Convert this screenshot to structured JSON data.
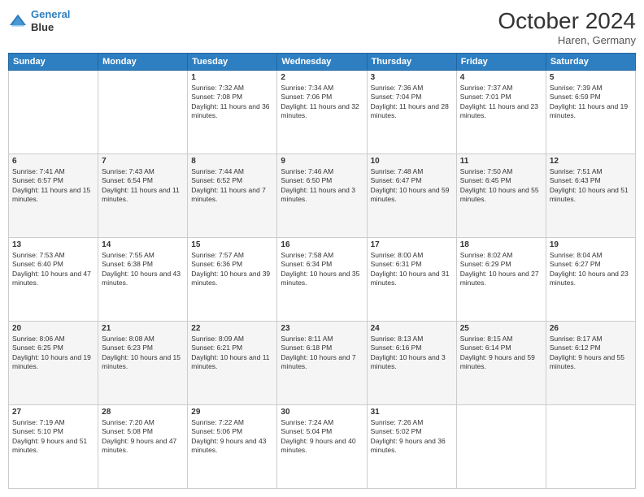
{
  "header": {
    "logo_line1": "General",
    "logo_line2": "Blue",
    "month": "October 2024",
    "location": "Haren, Germany"
  },
  "days_of_week": [
    "Sunday",
    "Monday",
    "Tuesday",
    "Wednesday",
    "Thursday",
    "Friday",
    "Saturday"
  ],
  "weeks": [
    [
      {
        "day": "",
        "info": ""
      },
      {
        "day": "",
        "info": ""
      },
      {
        "day": "1",
        "info": "Sunrise: 7:32 AM\nSunset: 7:08 PM\nDaylight: 11 hours and 36 minutes."
      },
      {
        "day": "2",
        "info": "Sunrise: 7:34 AM\nSunset: 7:06 PM\nDaylight: 11 hours and 32 minutes."
      },
      {
        "day": "3",
        "info": "Sunrise: 7:36 AM\nSunset: 7:04 PM\nDaylight: 11 hours and 28 minutes."
      },
      {
        "day": "4",
        "info": "Sunrise: 7:37 AM\nSunset: 7:01 PM\nDaylight: 11 hours and 23 minutes."
      },
      {
        "day": "5",
        "info": "Sunrise: 7:39 AM\nSunset: 6:59 PM\nDaylight: 11 hours and 19 minutes."
      }
    ],
    [
      {
        "day": "6",
        "info": "Sunrise: 7:41 AM\nSunset: 6:57 PM\nDaylight: 11 hours and 15 minutes."
      },
      {
        "day": "7",
        "info": "Sunrise: 7:43 AM\nSunset: 6:54 PM\nDaylight: 11 hours and 11 minutes."
      },
      {
        "day": "8",
        "info": "Sunrise: 7:44 AM\nSunset: 6:52 PM\nDaylight: 11 hours and 7 minutes."
      },
      {
        "day": "9",
        "info": "Sunrise: 7:46 AM\nSunset: 6:50 PM\nDaylight: 11 hours and 3 minutes."
      },
      {
        "day": "10",
        "info": "Sunrise: 7:48 AM\nSunset: 6:47 PM\nDaylight: 10 hours and 59 minutes."
      },
      {
        "day": "11",
        "info": "Sunrise: 7:50 AM\nSunset: 6:45 PM\nDaylight: 10 hours and 55 minutes."
      },
      {
        "day": "12",
        "info": "Sunrise: 7:51 AM\nSunset: 6:43 PM\nDaylight: 10 hours and 51 minutes."
      }
    ],
    [
      {
        "day": "13",
        "info": "Sunrise: 7:53 AM\nSunset: 6:40 PM\nDaylight: 10 hours and 47 minutes."
      },
      {
        "day": "14",
        "info": "Sunrise: 7:55 AM\nSunset: 6:38 PM\nDaylight: 10 hours and 43 minutes."
      },
      {
        "day": "15",
        "info": "Sunrise: 7:57 AM\nSunset: 6:36 PM\nDaylight: 10 hours and 39 minutes."
      },
      {
        "day": "16",
        "info": "Sunrise: 7:58 AM\nSunset: 6:34 PM\nDaylight: 10 hours and 35 minutes."
      },
      {
        "day": "17",
        "info": "Sunrise: 8:00 AM\nSunset: 6:31 PM\nDaylight: 10 hours and 31 minutes."
      },
      {
        "day": "18",
        "info": "Sunrise: 8:02 AM\nSunset: 6:29 PM\nDaylight: 10 hours and 27 minutes."
      },
      {
        "day": "19",
        "info": "Sunrise: 8:04 AM\nSunset: 6:27 PM\nDaylight: 10 hours and 23 minutes."
      }
    ],
    [
      {
        "day": "20",
        "info": "Sunrise: 8:06 AM\nSunset: 6:25 PM\nDaylight: 10 hours and 19 minutes."
      },
      {
        "day": "21",
        "info": "Sunrise: 8:08 AM\nSunset: 6:23 PM\nDaylight: 10 hours and 15 minutes."
      },
      {
        "day": "22",
        "info": "Sunrise: 8:09 AM\nSunset: 6:21 PM\nDaylight: 10 hours and 11 minutes."
      },
      {
        "day": "23",
        "info": "Sunrise: 8:11 AM\nSunset: 6:18 PM\nDaylight: 10 hours and 7 minutes."
      },
      {
        "day": "24",
        "info": "Sunrise: 8:13 AM\nSunset: 6:16 PM\nDaylight: 10 hours and 3 minutes."
      },
      {
        "day": "25",
        "info": "Sunrise: 8:15 AM\nSunset: 6:14 PM\nDaylight: 9 hours and 59 minutes."
      },
      {
        "day": "26",
        "info": "Sunrise: 8:17 AM\nSunset: 6:12 PM\nDaylight: 9 hours and 55 minutes."
      }
    ],
    [
      {
        "day": "27",
        "info": "Sunrise: 7:19 AM\nSunset: 5:10 PM\nDaylight: 9 hours and 51 minutes."
      },
      {
        "day": "28",
        "info": "Sunrise: 7:20 AM\nSunset: 5:08 PM\nDaylight: 9 hours and 47 minutes."
      },
      {
        "day": "29",
        "info": "Sunrise: 7:22 AM\nSunset: 5:06 PM\nDaylight: 9 hours and 43 minutes."
      },
      {
        "day": "30",
        "info": "Sunrise: 7:24 AM\nSunset: 5:04 PM\nDaylight: 9 hours and 40 minutes."
      },
      {
        "day": "31",
        "info": "Sunrise: 7:26 AM\nSunset: 5:02 PM\nDaylight: 9 hours and 36 minutes."
      },
      {
        "day": "",
        "info": ""
      },
      {
        "day": "",
        "info": ""
      }
    ]
  ]
}
